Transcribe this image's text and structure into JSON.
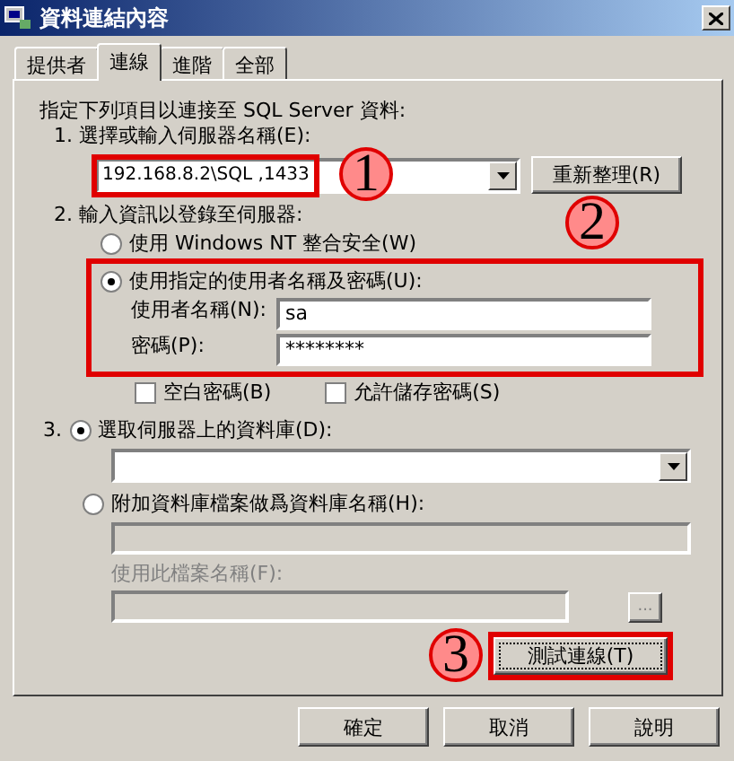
{
  "window": {
    "title": "資料連結內容"
  },
  "tabs": [
    {
      "label": "提供者",
      "selected": false
    },
    {
      "label": "連線",
      "selected": true
    },
    {
      "label": "進階",
      "selected": false
    },
    {
      "label": "全部",
      "selected": false
    }
  ],
  "intro": "指定下列項目以連接至 SQL Server 資料:",
  "server": {
    "label": "1. 選擇或輸入伺服器名稱(E):",
    "value": "192.168.8.2\\SQL ,1433",
    "highlighted": true,
    "annotation": "1",
    "refresh_button": "重新整理(R)"
  },
  "login": {
    "label": "2. 輸入資訊以登錄至伺服器:",
    "options": [
      {
        "label": "使用 Windows NT 整合安全(W)",
        "selected": false,
        "highlighted": false
      },
      {
        "label": "使用指定的使用者名稱及密碼(U):",
        "selected": true,
        "highlighted": true,
        "annotation": "2"
      }
    ],
    "username": {
      "label": "使用者名稱(N):",
      "value": "sa"
    },
    "password": {
      "label": "密碼(P):",
      "value": "********"
    },
    "checkboxes": [
      {
        "label": "空白密碼(B)",
        "checked": false
      },
      {
        "label": "允許儲存密碼(S)",
        "checked": false
      }
    ]
  },
  "database": {
    "number": "3.",
    "options": [
      {
        "label": "選取伺服器上的資料庫(D):",
        "selected": true
      },
      {
        "label": "附加資料庫檔案做爲資料庫名稱(H):",
        "selected": false
      }
    ],
    "file_name": {
      "label": "使用此檔案名稱(F):",
      "disabled": true,
      "browse": "..."
    }
  },
  "test_button": {
    "label": "測試連線(T)",
    "highlighted": true,
    "annotation": "3"
  },
  "buttons": [
    "確定",
    "取消",
    "說明"
  ]
}
